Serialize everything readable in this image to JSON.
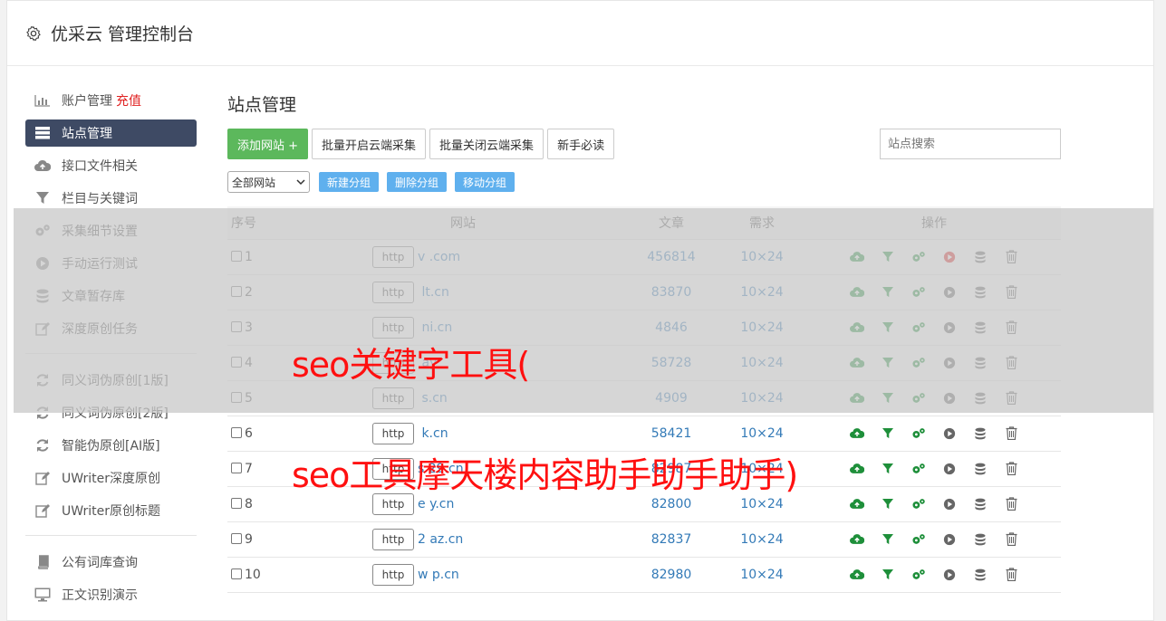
{
  "header": {
    "title": "优采云 管理控制台",
    "icon": "gear-icon"
  },
  "sidebar": {
    "group1": [
      {
        "label": "账户管理",
        "extra": "充值",
        "icon": "bar-chart-icon"
      },
      {
        "label": "站点管理",
        "icon": "server-list-icon",
        "active": true
      },
      {
        "label": "接口文件相关",
        "icon": "cloud-upload-icon"
      },
      {
        "label": "栏目与关键词",
        "icon": "filter-icon"
      },
      {
        "label": "采集细节设置",
        "icon": "cogs-icon"
      },
      {
        "label": "手动运行测试",
        "icon": "play-circle-icon"
      },
      {
        "label": "文章暂存库",
        "icon": "database-icon"
      },
      {
        "label": "深度原创任务",
        "icon": "edit-icon"
      }
    ],
    "group2": [
      {
        "label": "同义词伪原创[1版]",
        "icon": "refresh-icon"
      },
      {
        "label": "同义词伪原创[2版]",
        "icon": "refresh-icon"
      },
      {
        "label": "智能伪原创[AI版]",
        "icon": "refresh-icon"
      },
      {
        "label": "UWriter深度原创",
        "icon": "edit-icon"
      },
      {
        "label": "UWriter原创标题",
        "icon": "edit-icon"
      }
    ],
    "group3": [
      {
        "label": "公有词库查询",
        "icon": "book-icon"
      },
      {
        "label": "正文识别演示",
        "icon": "monitor-icon"
      }
    ]
  },
  "main": {
    "title": "站点管理",
    "buttons": {
      "add": "添加网站 +",
      "batch_on": "批量开启云端采集",
      "batch_off": "批量关闭云端采集",
      "guide": "新手必读"
    },
    "search_placeholder": "站点搜索",
    "group_select": "全部网站",
    "group_buttons": {
      "new": "新建分组",
      "delete": "删除分组",
      "move": "移动分组"
    },
    "table": {
      "headers": {
        "no": "序号",
        "site": "网站",
        "articles": "文章",
        "demand": "需求",
        "ops": "操作"
      },
      "rows": [
        {
          "no": "1",
          "http": "http",
          "site": "v           .com",
          "articles": "456814",
          "demand": "10×24",
          "running": true
        },
        {
          "no": "2",
          "http": "http",
          "site": "    lt.cn",
          "articles": "83870",
          "demand": "10×24"
        },
        {
          "no": "3",
          "http": "http",
          "site": "     ni.cn",
          "articles": "4846",
          "demand": "10×24"
        },
        {
          "no": "4",
          "http": "http",
          "site": "         ay",
          "articles": "58728",
          "demand": "10×24"
        },
        {
          "no": "5",
          "http": "http",
          "site": "        s.cn",
          "articles": "4909",
          "demand": "10×24"
        },
        {
          "no": "6",
          "http": "http",
          "site": "     k.cn",
          "articles": "58421",
          "demand": "10×24"
        },
        {
          "no": "7",
          "http": "http",
          "site": "s   29.cn",
          "articles": "82987",
          "demand": "10×24"
        },
        {
          "no": "8",
          "http": "http",
          "site": "e     y.cn",
          "articles": "82800",
          "demand": "10×24"
        },
        {
          "no": "9",
          "http": "http",
          "site": "2     az.cn",
          "articles": "82837",
          "demand": "10×24"
        },
        {
          "no": "10",
          "http": "http",
          "site": "w     p.cn",
          "articles": "82980",
          "demand": "10×24"
        }
      ]
    }
  },
  "overlay": {
    "line1": "seo关键字工具(",
    "line2": "seo工具摩天楼内容助手助手助手)"
  },
  "colors": {
    "accent": "#3e4a64",
    "green": "#5cb85c",
    "link": "#337ab7",
    "danger": "#e02020",
    "overlay_text": "#ff1010"
  }
}
